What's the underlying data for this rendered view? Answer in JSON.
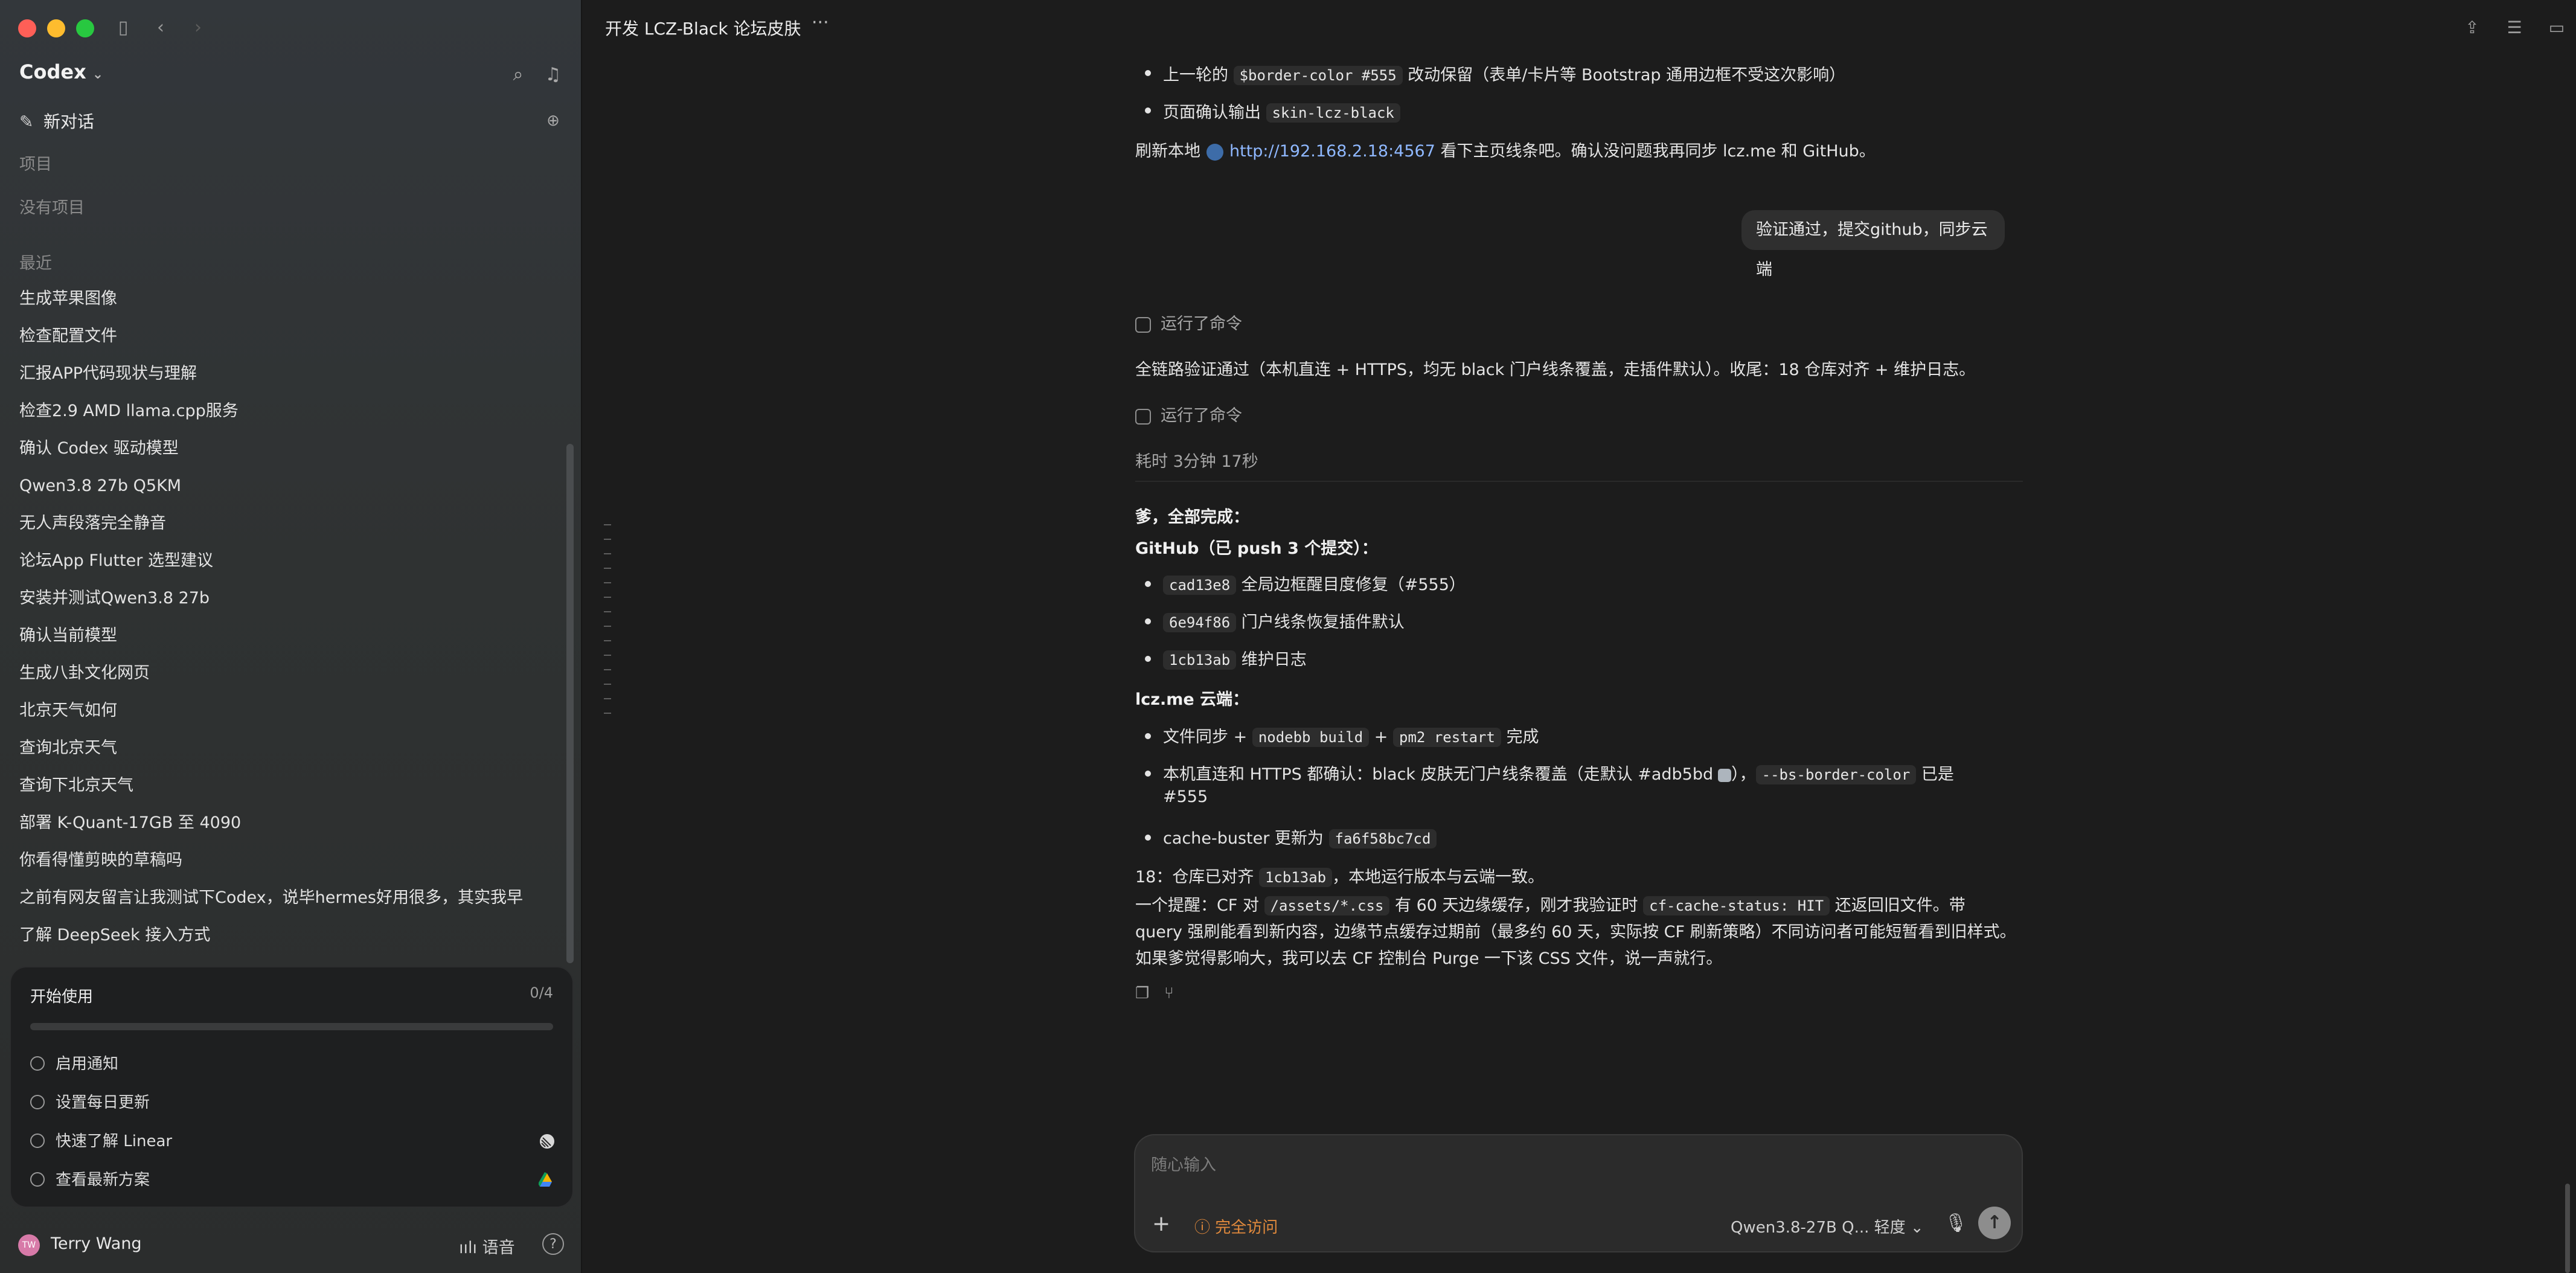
{
  "colors": {
    "close": "#ff5f57",
    "minimize": "#febc2e",
    "maximize": "#28c840",
    "access": "#e28a3c",
    "link": "#8fb8ff",
    "swatch": "#adb5bd",
    "avatar": "#d77aa8"
  },
  "sidebar": {
    "brand": "Codex",
    "new_chat": "新对话",
    "projects_label": "项目",
    "no_projects": "没有项目",
    "recent_label": "最近",
    "chats": [
      "生成苹果图像",
      "检查配置文件",
      "汇报APP代码现状与理解",
      "检查2.9 AMD llama.cpp服务",
      "确认 Codex 驱动模型",
      "Qwen3.8 27b Q5KM",
      "无人声段落完全静音",
      "论坛App Flutter 选型建议",
      "安装并测试Qwen3.8 27b",
      "确认当前模型",
      "生成八卦文化网页",
      "北京天气如何",
      "查询北京天气",
      "查询下北京天气",
      "部署 K-Quant-17GB 至 4090",
      "你看得懂剪映的草稿吗",
      "之前有网友留言让我测试下Codex，说毕hermes好用很多，其实我早",
      "了解 DeepSeek 接入方式"
    ],
    "start": {
      "title": "开始使用",
      "count": "0/4",
      "progress": 0,
      "tasks": [
        "启用通知",
        "设置每日更新",
        "快速了解 Linear",
        "查看最新方案"
      ]
    },
    "user": {
      "initials": "TW",
      "name": "Terry Wang",
      "voice": "语音",
      "help": "?"
    }
  },
  "main": {
    "title": "开发 LCZ-Black 论坛皮肤",
    "more": "···",
    "msg1": {
      "b1_pre": "上一轮的",
      "b1_code": "$border-color #555",
      "b1_post": "改动保留（表单/卡片等 Bootstrap 通用边框不受这次影响）",
      "b2_pre": "页面确认输出",
      "b2_code": "skin-lcz-black",
      "refresh_pre": "刷新本地",
      "refresh_link": "http://192.168.2.18:4567",
      "refresh_post": "看下主页线条吧。确认没问题我再同步 lcz.me 和 GitHub。"
    },
    "user_message": "验证通过，提交github，同步云端",
    "ran_command": "运行了命令",
    "verify_text": "全链路验证通过（本机直连 + HTTPS，均无 black 门户线条覆盖，走插件默认）。收尾：18 仓库对齐 + 维护日志。",
    "ran_command2": "运行了命令",
    "elapsed": "耗时 3分钟 17秒",
    "done": {
      "intro": "爹，全部完成：",
      "github_head": "GitHub（已 push 3 个提交）：",
      "commits": [
        {
          "hash": "cad13e8",
          "msg": "全局边框醒目度修复（#555）"
        },
        {
          "hash": "6e94f86",
          "msg": "门户线条恢复插件默认"
        },
        {
          "hash": "1cb13ab",
          "msg": "维护日志"
        }
      ],
      "cloud_head": "lcz.me 云端：",
      "c1_pre": "文件同步 +",
      "c1_code1": "nodebb build",
      "c1_plus": "+",
      "c1_code2": "pm2 restart",
      "c1_post": "完成",
      "c2_pre": "本机直连和 HTTPS 都确认：black 皮肤无门户线条覆盖（走默认 #adb5bd",
      "c2_mid": "），",
      "c2_code": "--bs-border-color",
      "c2_post": "已是",
      "c2_cont": "#555",
      "c3_pre": "cache-buster 更新为",
      "c3_code": "fa6f58bc7cd",
      "r18_pre": "18：仓库已对齐",
      "r18_code": "1cb13ab",
      "r18_post": "，本地运行版本与云端一致。",
      "tip_pre": "一个提醒：CF 对",
      "tip_code1": "/assets/*.css",
      "tip_mid": "有 60 天边缘缓存，刚才我验证时",
      "tip_code2": "cf-cache-status: HIT",
      "tip_post": "还返回旧文件。带 query 强刷能看到新内容，边缘节点缓存过期前（最多约 60 天，实际按 CF 刷新策略）不同访问者可能短暂看到旧样式。如果爹觉得影响大，我可以去 CF 控制台 Purge 一下该 CSS 文件，说一声就行。"
    },
    "composer": {
      "placeholder": "随心输入",
      "access": "完全访问",
      "model": "Qwen3.8-27B Q... 轻度 ⌄"
    }
  }
}
